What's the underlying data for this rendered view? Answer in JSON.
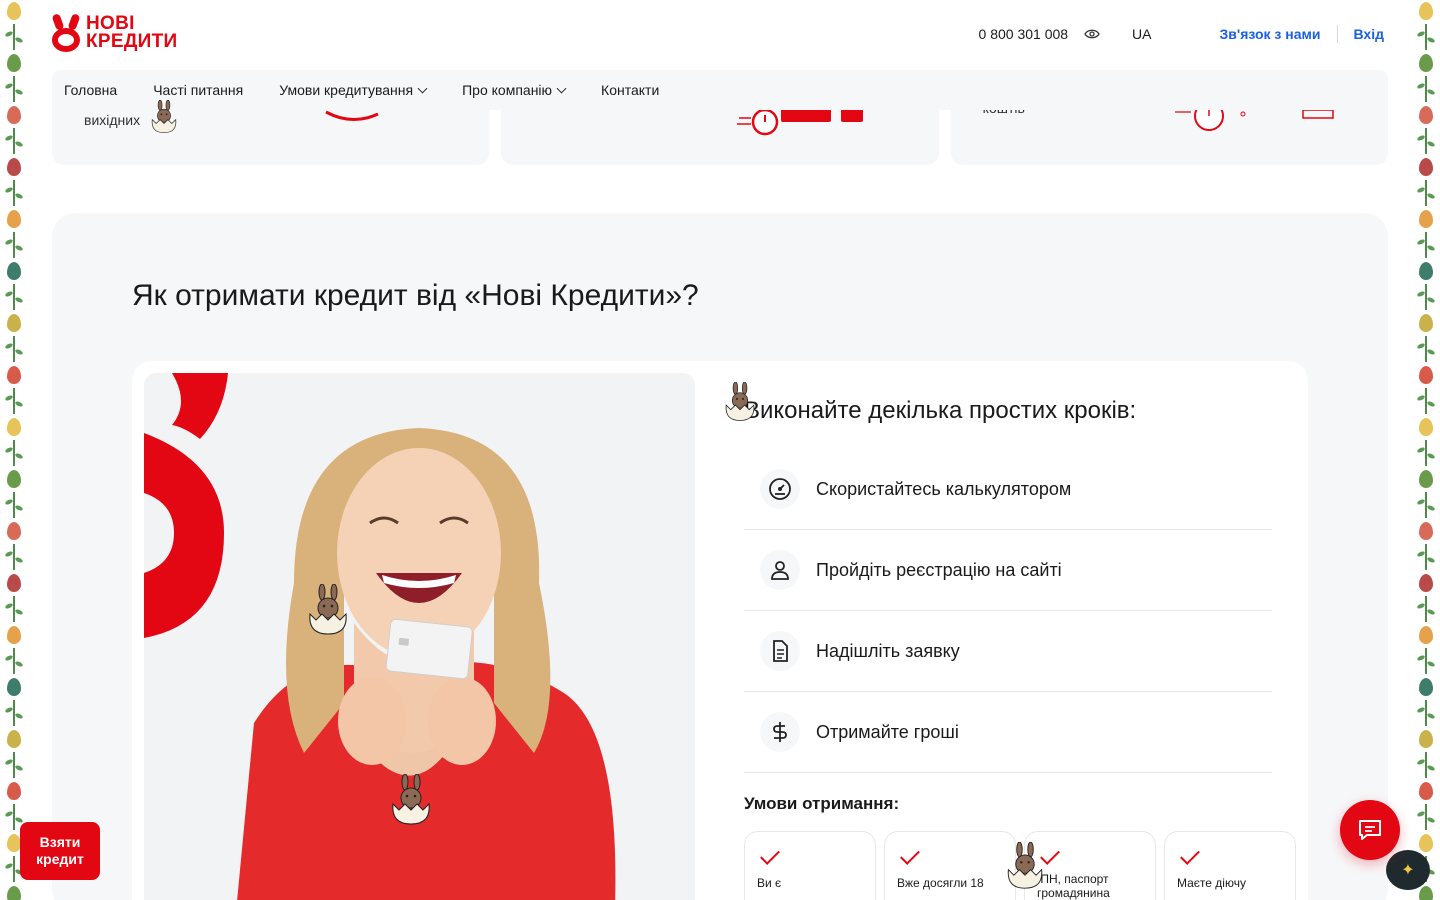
{
  "brand": {
    "name_line1": "НОВІ",
    "name_line2": "КРЕДИТИ",
    "accent_color": "#e30613",
    "link_color": "#1a5fe0"
  },
  "header": {
    "phone": "0 800 301 008",
    "accessibility_icon": "eye-icon",
    "language": "UA",
    "contact_link": "Зв'язок з нами",
    "login_link": "Вхід"
  },
  "nav": {
    "items": [
      {
        "label": "Головна"
      },
      {
        "label": "Часті питання"
      },
      {
        "label": "Умови кредитування"
      },
      {
        "label": "Про компанію"
      },
      {
        "label": "Контакти"
      }
    ]
  },
  "strip": {
    "card1_text": "вихідних",
    "card3_text": "коштів"
  },
  "main": {
    "title": "Як отримати кредит від «Нові Кредити»?",
    "steps_title": "Виконайте декілька простих кроків:",
    "steps": [
      {
        "label": "Скористайтесь калькулятором",
        "icon": "speedometer-icon"
      },
      {
        "label": "Пройдіть реєстрацію на сайті",
        "icon": "user-icon"
      },
      {
        "label": "Надішліть заявку",
        "icon": "document-icon"
      },
      {
        "label": "Отримайте гроші",
        "icon": "dollar-icon"
      }
    ],
    "conditions_title": "Умови отримання:",
    "conditions": [
      {
        "text": "Ви є"
      },
      {
        "text": "Вже досягли 18"
      },
      {
        "text": "ІПН, паспорт громадянина"
      },
      {
        "text": "Маєте діючу"
      }
    ]
  },
  "floating": {
    "take_credit_line1": "Взяти",
    "take_credit_line2": "кредит",
    "chat_icon": "chat-icon",
    "ai_icon": "sparkle-icon"
  }
}
